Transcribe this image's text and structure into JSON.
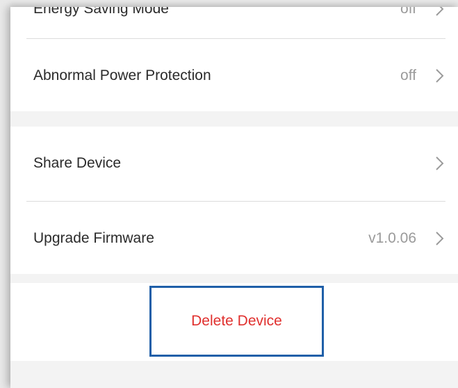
{
  "settings": {
    "energy_saving": {
      "label": "Energy Saving Mode",
      "value": "off"
    },
    "abnormal_power": {
      "label": "Abnormal Power Protection",
      "value": "off"
    },
    "share_device": {
      "label": "Share Device"
    },
    "upgrade_firmware": {
      "label": "Upgrade Firmware",
      "value": "v1.0.06"
    }
  },
  "actions": {
    "delete_label": "Delete Device"
  },
  "colors": {
    "delete_text": "#e0302e",
    "highlight_border": "#1f5fa8",
    "group_gap": "#f3f3f3",
    "value_text": "#9a9a9a"
  },
  "icons": {
    "row_arrow": "chevron-right-icon"
  }
}
